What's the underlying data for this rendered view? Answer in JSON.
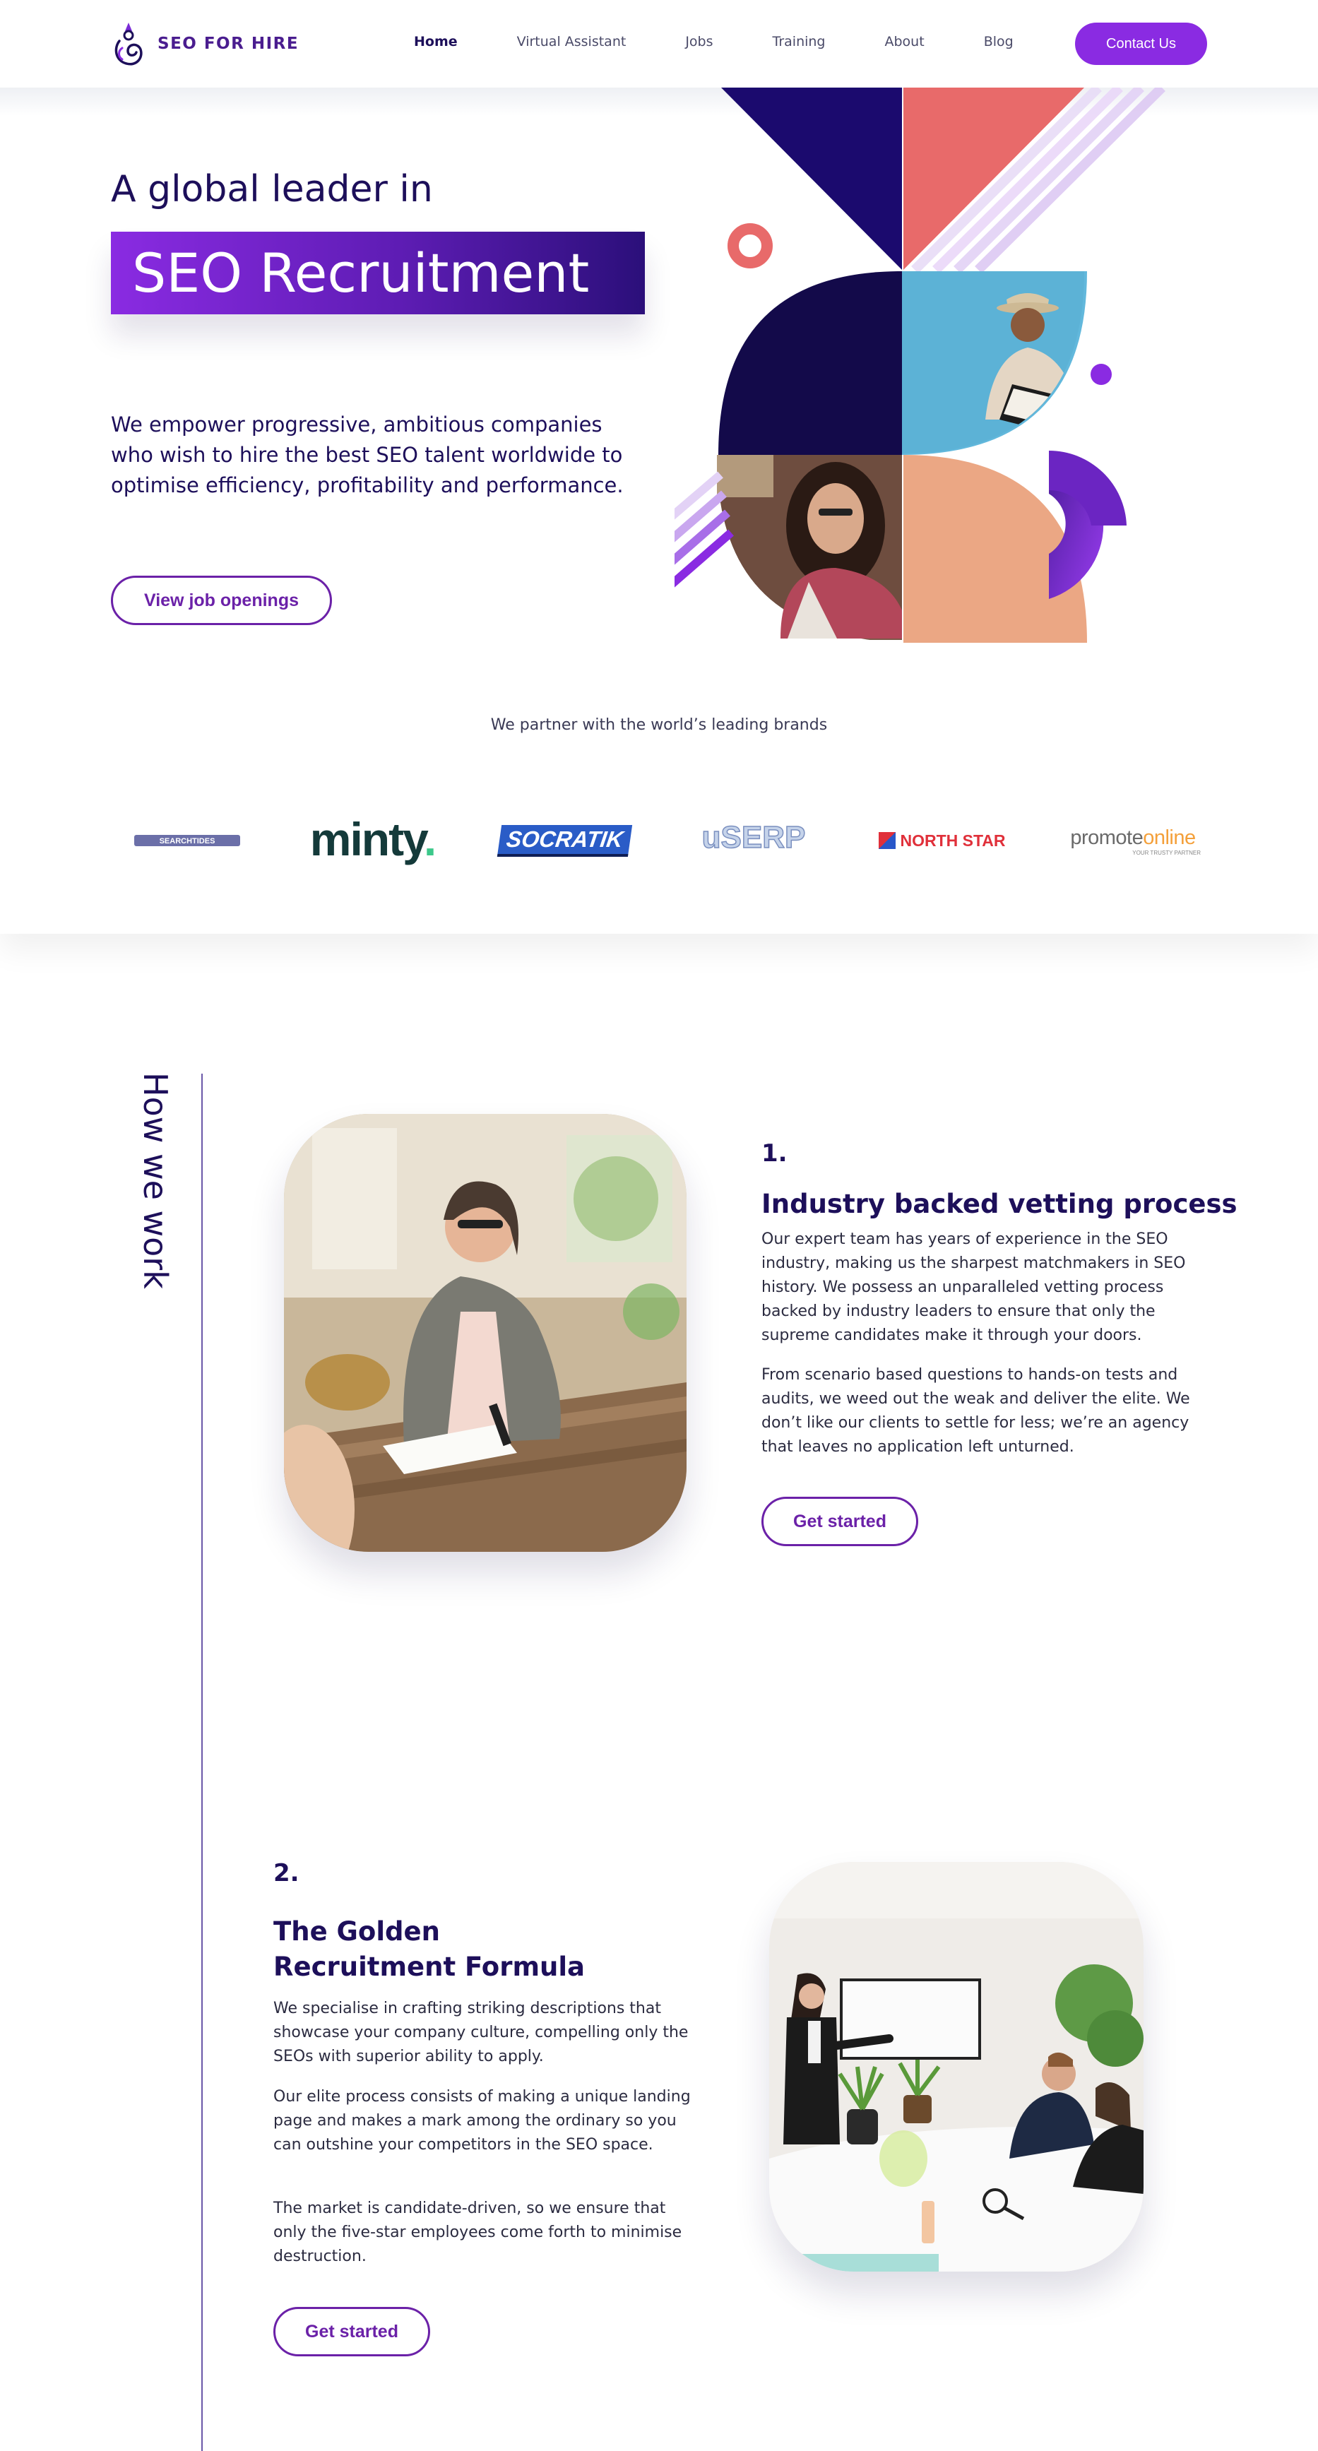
{
  "header": {
    "logo_text": "SEO FOR HIRE",
    "nav": [
      "Home",
      "Virtual Assistant",
      "Jobs",
      "Training",
      "About",
      "Blog"
    ],
    "active_nav": "Home",
    "contact_label": "Contact Us"
  },
  "hero": {
    "line1": "A global leader in",
    "line2": "SEO Recruitment",
    "description": "We empower progressive, ambitious companies who wish to hire the best SEO talent worldwide to optimise efficiency, profitability and performance.",
    "cta_label": "View job openings"
  },
  "partners": {
    "heading": "We partner with the world’s leading brands",
    "brands": [
      "SEARCHTIDES",
      "minty.",
      "SOCRATIK",
      "uSERP",
      "NORTH STAR",
      "promoteonline"
    ],
    "promote_tagline": "YOUR TRUSTY PARTNER"
  },
  "how": {
    "title": "How we work",
    "steps": [
      {
        "number": "1.",
        "title": "Industry backed vetting process",
        "paragraphs": [
          "Our expert team has years of experience in the SEO industry, making us the sharpest matchmakers in SEO history. We possess an unparalleled vetting process backed by industry leaders to ensure that only the supreme candidates make it through your doors.",
          "From scenario based questions to hands-on tests and audits, we weed out the weak and deliver the elite. We don’t like our clients to settle for less; we’re an agency that leaves no application left unturned."
        ],
        "cta": "Get started"
      },
      {
        "number": "2.",
        "title": "The Golden Recruitment Formula",
        "paragraphs": [
          "We specialise in crafting striking descriptions that showcase your company culture, compelling only the SEOs with superior ability to apply.",
          "Our elite process consists of making a unique landing page and makes a mark among the ordinary so you can outshine your competitors in the SEO space.",
          "The market is candidate-driven, so we ensure that only the five-star employees come forth to minimise destruction."
        ],
        "cta": "Get started"
      }
    ]
  },
  "colors": {
    "primary_purple": "#8a2be2",
    "navy": "#1d0f5a",
    "coral": "#e86a6a",
    "peach": "#eba784",
    "sky": "#5bb4d8"
  }
}
